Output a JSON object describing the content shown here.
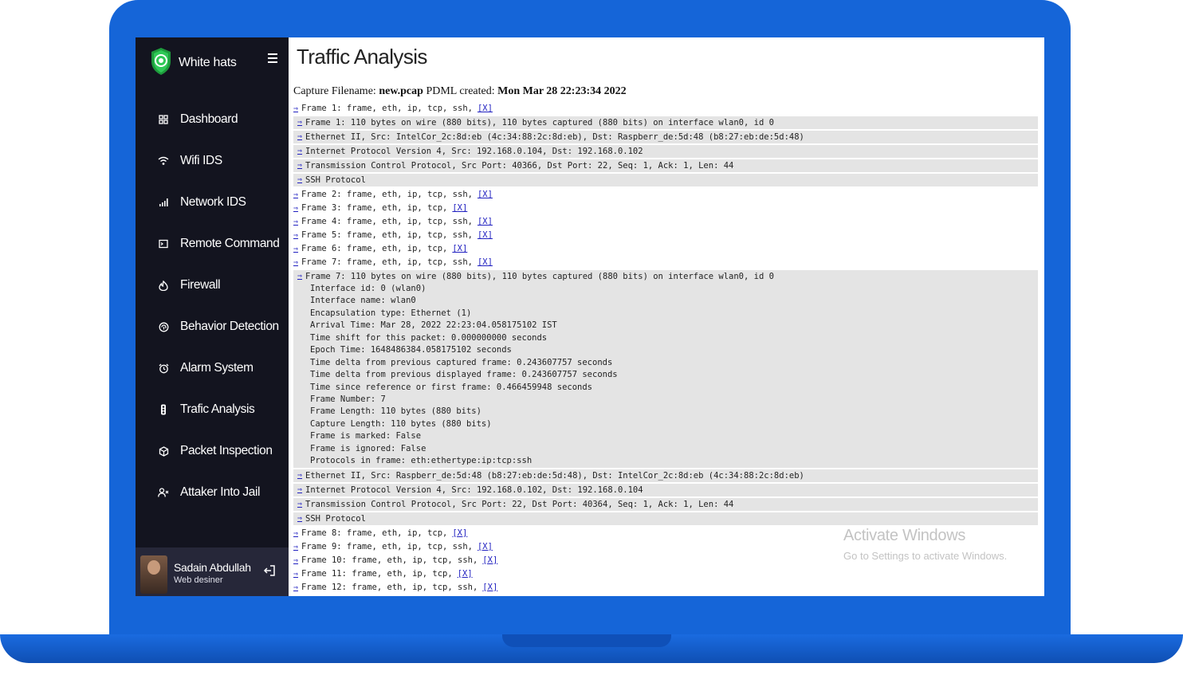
{
  "app": {
    "brand": "White hats",
    "accent_color": "#1565d8",
    "sidebar_bg": "#13141f"
  },
  "sidebar": {
    "items": [
      {
        "label": "Dashboard",
        "icon": "grid-icon"
      },
      {
        "label": "Wifi IDS",
        "icon": "wifi-icon"
      },
      {
        "label": "Network IDS",
        "icon": "signal-bars-icon"
      },
      {
        "label": "Remote Command",
        "icon": "terminal-icon"
      },
      {
        "label": "Firewall",
        "icon": "flame-icon"
      },
      {
        "label": "Behavior Detection",
        "icon": "fingerprint-icon"
      },
      {
        "label": "Alarm System",
        "icon": "alarm-clock-icon"
      },
      {
        "label": "Trafic Analysis",
        "icon": "traffic-light-icon"
      },
      {
        "label": "Packet Inspection",
        "icon": "package-icon"
      },
      {
        "label": "Attaker Into Jail",
        "icon": "user-remove-icon"
      }
    ],
    "profile": {
      "name": "Sadain Abdullah",
      "role": "Web desiner"
    }
  },
  "main": {
    "title": "Traffic Analysis",
    "capture": {
      "prefix": "Capture Filename:",
      "filename": "new.pcap",
      "mid": "PDML created:",
      "created": "Mon Mar 28 22:23:34 2022"
    },
    "arrow": "⇒",
    "x_label": "[X]",
    "frames_top": [
      "Frame 1: frame, eth, ip, tcp, ssh,"
    ],
    "frame1_details": [
      "Frame 1: 110 bytes on wire (880 bits), 110 bytes captured (880 bits) on interface wlan0, id 0",
      "Ethernet II, Src: IntelCor_2c:8d:eb (4c:34:88:2c:8d:eb), Dst: Raspberr_de:5d:48 (b8:27:eb:de:5d:48)",
      "Internet Protocol Version 4, Src: 192.168.0.104, Dst: 192.168.0.102",
      "Transmission Control Protocol, Src Port: 40366, Dst Port: 22, Seq: 1, Ack: 1, Len: 44",
      "SSH Protocol"
    ],
    "frames_mid": [
      "Frame 2: frame, eth, ip, tcp, ssh,",
      "Frame 3: frame, eth, ip, tcp,",
      "Frame 4: frame, eth, ip, tcp, ssh,",
      "Frame 5: frame, eth, ip, tcp, ssh,",
      "Frame 6: frame, eth, ip, tcp,",
      "Frame 7: frame, eth, ip, tcp, ssh,"
    ],
    "frame7_head": "Frame 7: 110 bytes on wire (880 bits), 110 bytes captured (880 bits) on interface wlan0, id 0",
    "frame7_fields": [
      "Interface id: 0 (wlan0)",
      "Interface name: wlan0",
      "Encapsulation type: Ethernet (1)",
      "Arrival Time: Mar 28, 2022 22:23:04.058175102 IST",
      "Time shift for this packet: 0.000000000 seconds",
      "Epoch Time: 1648486384.058175102 seconds",
      "Time delta from previous captured frame: 0.243607757 seconds",
      "Time delta from previous displayed frame: 0.243607757 seconds",
      "Time since reference or first frame: 0.466459948 seconds",
      "Frame Number: 7",
      "Frame Length: 110 bytes (880 bits)",
      "Capture Length: 110 bytes (880 bits)",
      "Frame is marked: False",
      "Frame is ignored: False",
      "Protocols in frame: eth:ethertype:ip:tcp:ssh"
    ],
    "frame7_details": [
      "Ethernet II, Src: Raspberr_de:5d:48 (b8:27:eb:de:5d:48), Dst: IntelCor_2c:8d:eb (4c:34:88:2c:8d:eb)",
      "Internet Protocol Version 4, Src: 192.168.0.102, Dst: 192.168.0.104",
      "Transmission Control Protocol, Src Port: 22, Dst Port: 40364, Seq: 1, Ack: 1, Len: 44",
      "SSH Protocol"
    ],
    "frames_bottom": [
      "Frame 8: frame, eth, ip, tcp,",
      "Frame 9: frame, eth, ip, tcp, ssh,",
      "Frame 10: frame, eth, ip, tcp, ssh,",
      "Frame 11: frame, eth, ip, tcp,",
      "Frame 12: frame, eth, ip, tcp, ssh,"
    ]
  },
  "watermark": {
    "title": "Activate Windows",
    "subtitle": "Go to Settings to activate Windows."
  }
}
